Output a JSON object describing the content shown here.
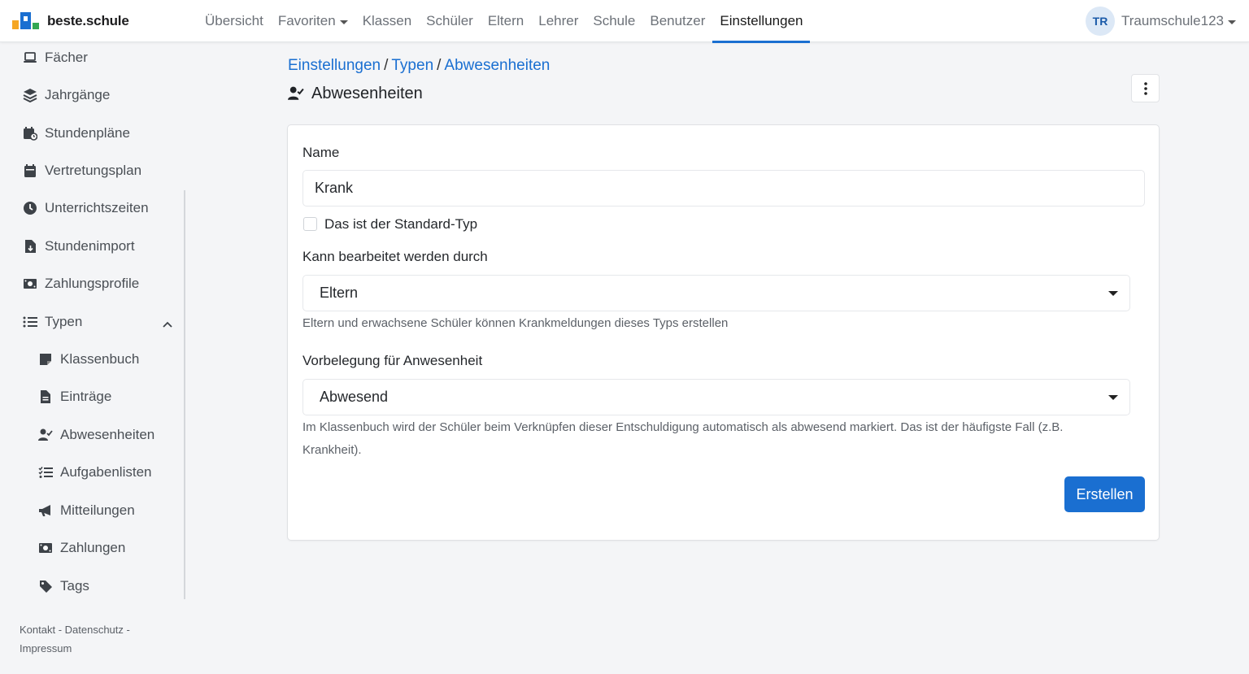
{
  "brand": {
    "name": "beste.schule"
  },
  "nav": {
    "items": [
      {
        "label": "Übersicht",
        "name": "nav-uebersicht"
      },
      {
        "label": "Favoriten",
        "name": "nav-favoriten",
        "dropdown": true
      },
      {
        "label": "Klassen",
        "name": "nav-klassen"
      },
      {
        "label": "Schüler",
        "name": "nav-schueler"
      },
      {
        "label": "Eltern",
        "name": "nav-eltern"
      },
      {
        "label": "Lehrer",
        "name": "nav-lehrer"
      },
      {
        "label": "Schule",
        "name": "nav-schule"
      },
      {
        "label": "Benutzer",
        "name": "nav-benutzer"
      },
      {
        "label": "Einstellungen",
        "name": "nav-einstellungen",
        "active": true
      }
    ]
  },
  "user": {
    "initials": "TR",
    "name": "Traumschule123"
  },
  "sidebar": {
    "items": [
      {
        "label": "Fächer",
        "icon": "laptop-icon"
      },
      {
        "label": "Jahrgänge",
        "icon": "layers-icon"
      },
      {
        "label": "Stundenpläne",
        "icon": "calendar-clock-icon"
      },
      {
        "label": "Vertretungsplan",
        "icon": "calendar-icon"
      },
      {
        "label": "Unterrichtszeiten",
        "icon": "clock-icon"
      },
      {
        "label": "Stundenimport",
        "icon": "file-import-icon"
      },
      {
        "label": "Zahlungsprofile",
        "icon": "money-icon"
      },
      {
        "label": "Typen",
        "icon": "list-icon",
        "expanded": true
      }
    ],
    "sub_items": [
      {
        "label": "Klassenbuch",
        "icon": "note-icon"
      },
      {
        "label": "Einträge",
        "icon": "file-text-icon"
      },
      {
        "label": "Abwesenheiten",
        "icon": "user-check-icon",
        "active": true
      },
      {
        "label": "Aufgabenlisten",
        "icon": "checklist-icon"
      },
      {
        "label": "Mitteilungen",
        "icon": "megaphone-icon"
      },
      {
        "label": "Zahlungen",
        "icon": "money-icon"
      },
      {
        "label": "Tags",
        "icon": "tag-icon"
      }
    ],
    "footer": "Kontakt - Datenschutz - Impressum"
  },
  "breadcrumb": {
    "items": [
      "Einstellungen",
      "Typen",
      "Abwesenheiten"
    ],
    "separator": "/"
  },
  "page": {
    "title": "Abwesenheiten",
    "title_icon": "user-check-icon"
  },
  "form": {
    "name_label": "Name",
    "name_value": "Krank",
    "default_checkbox_label": "Das ist der Standard-Typ",
    "default_checked": false,
    "editable_label": "Kann bearbeitet werden durch",
    "editable_value": "Eltern",
    "editable_hint": "Eltern und erwachsene Schüler können Krankmeldungen dieses Typs erstellen",
    "presence_label": "Vorbelegung für Anwesenheit",
    "presence_value": "Abwesend",
    "presence_hint": "Im Klassenbuch wird der Schüler beim Verknüpfen dieser Entschuldigung automatisch als abwesend markiert. Das ist der häufigste Fall (z.B. Krankheit).",
    "submit_label": "Erstellen"
  },
  "colors": {
    "accent": "#1a6fd1",
    "background": "#f4f5f7"
  }
}
